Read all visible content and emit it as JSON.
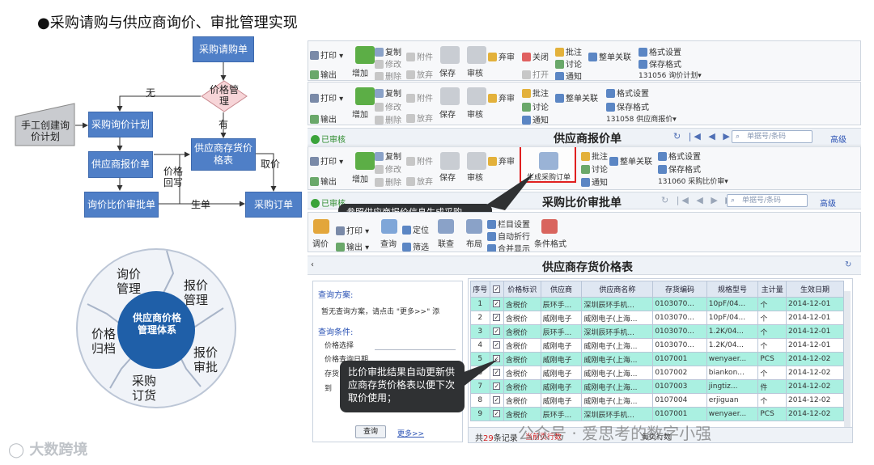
{
  "title": "●采购请购与供应商询价、审批管理实现",
  "flow": {
    "purchase_request": "采购请购单",
    "price_manage": "价格管理",
    "no": "无",
    "yes": "有",
    "manual_create": "手工创建询价计划",
    "inquiry_plan": "采购询价计划",
    "supplier_quote": "供应商报价单",
    "stock_price": "供应商存货价格表",
    "fetch_price": "取价",
    "price_writeback": "价格回写",
    "compare_approve": "询价比价审批单",
    "gen_order": "生单",
    "purchase_order": "采购订单"
  },
  "cycle": {
    "center": "供应商价格管理体系",
    "seg1": "询价管理",
    "seg2": "报价管理",
    "seg3": "报价审批",
    "seg4": "采购订货",
    "seg5": "价格归档"
  },
  "toolbar1": {
    "print": "打印",
    "export": "输出",
    "add": "增加",
    "copy": "复制",
    "modify": "修改",
    "delete": "删除",
    "attach": "附件",
    "abandon": "放弃",
    "save": "保存",
    "audit": "审核",
    "unaudit": "弃审",
    "close": "关闭",
    "open": "打开",
    "approve": "批注",
    "discuss": "讨论",
    "notify": "通知",
    "link": "整单关联",
    "fmt_set": "格式设置",
    "save_fmt": "保存格式",
    "template": "131056 询价计划▾"
  },
  "toolbar2": {
    "print": "打印",
    "export": "输出",
    "add": "增加",
    "copy": "复制",
    "modify": "修改",
    "delete": "删除",
    "attach": "附件",
    "abandon": "放弃",
    "save": "保存",
    "audit": "审核",
    "unaudit": "弃审",
    "approve": "批注",
    "discuss": "讨论",
    "notify": "通知",
    "link": "整单关联",
    "fmt_set": "格式设置",
    "save_fmt": "保存格式",
    "template": "131058 供应商报价▾"
  },
  "quote_bar": {
    "status": "已审核",
    "title": "供应商报价单",
    "search_placeholder": "单据号/条码",
    "advanced": "高级"
  },
  "toolbar3": {
    "print": "打印",
    "export": "输出",
    "add": "增加",
    "copy": "复制",
    "modify": "修改",
    "delete": "删除",
    "attach": "附件",
    "abandon": "放弃",
    "save": "保存",
    "audit": "审核",
    "unaudit": "弃审",
    "gen_order": "生成采购订单",
    "approve": "批注",
    "discuss": "讨论",
    "notify": "通知",
    "link": "整单关联",
    "fmt_set": "格式设置",
    "save_fmt": "保存格式",
    "template": "131060 采购比价审▾"
  },
  "compare_bar": {
    "status": "已审核",
    "title": "采购比价审批单",
    "search_placeholder": "单据号/条码",
    "advanced": "高级"
  },
  "toolbar4": {
    "adjust": "调价",
    "print": "打印",
    "export": "输出",
    "query": "查询",
    "locate": "定位",
    "filter": "筛选",
    "linked": "联查",
    "layout": "布局",
    "col_set": "栏目设置",
    "auto_wrap": "自动折行",
    "merge": "合并显示",
    "cond_fmt": "条件格式"
  },
  "price_bar": {
    "title": "供应商存货价格表"
  },
  "query_panel": {
    "scheme_label": "查询方案:",
    "no_scheme": "暂无查询方案，请点击 \"更多>>\" 添",
    "cond_label": "查询条件:",
    "f1": "价格选择",
    "f2": "价格查询日期",
    "f3": "存货",
    "f4": "到",
    "query_btn": "查询",
    "more": "更多>>"
  },
  "callout_top": "参照供应商报价信息生成采购",
  "callout_bottom": "比价审批结果自动更新供应商存货价格表以便下次取价使用；",
  "table": {
    "headers": [
      "序号",
      "",
      "价格标识",
      "供应商",
      "供应商名称",
      "存货编码",
      "规格型号",
      "主计量",
      "生效日期"
    ],
    "rows": [
      [
        "1",
        "含税价",
        "辰环手...",
        "深圳辰环手机...",
        "0103070...",
        "10pF/04...",
        "个",
        "2014-12-01"
      ],
      [
        "2",
        "含税价",
        "威刚电子",
        "威刚电子(上海...",
        "0103070...",
        "10pF/04...",
        "个",
        "2014-12-01"
      ],
      [
        "3",
        "含税价",
        "辰环手...",
        "深圳辰环手机...",
        "0103070...",
        "1.2K/04...",
        "个",
        "2014-12-01"
      ],
      [
        "4",
        "含税价",
        "威刚电子",
        "威刚电子(上海...",
        "0103070...",
        "1.2K/04...",
        "个",
        "2014-12-01"
      ],
      [
        "5",
        "含税价",
        "威刚电子",
        "威刚电子(上海...",
        "0107001",
        "wenyaer...",
        "PCS",
        "2014-12-02"
      ],
      [
        "6",
        "含税价",
        "威刚电子",
        "威刚电子(上海...",
        "0107002",
        "biankon...",
        "个",
        "2014-12-02"
      ],
      [
        "7",
        "含税价",
        "威刚电子",
        "威刚电子(上海...",
        "0107003",
        "jingtiz...",
        "件",
        "2014-12-02"
      ],
      [
        "8",
        "含税价",
        "威刚电子",
        "威刚电子(上海...",
        "0107004",
        "erjiguan",
        "个",
        "2014-12-02"
      ],
      [
        "9",
        "含税价",
        "辰环手...",
        "深圳辰环手机...",
        "0107001",
        "wenyaer...",
        "PCS",
        "2014-12-02"
      ]
    ]
  },
  "footer": {
    "total_prefix": "共",
    "total_num": "29",
    "total_suffix": "条记录",
    "cur_page": "当前页行数",
    "per_page": "每页行数"
  },
  "watermark": "公众号 · 爱思考的数字小强",
  "logo": "大数跨境"
}
